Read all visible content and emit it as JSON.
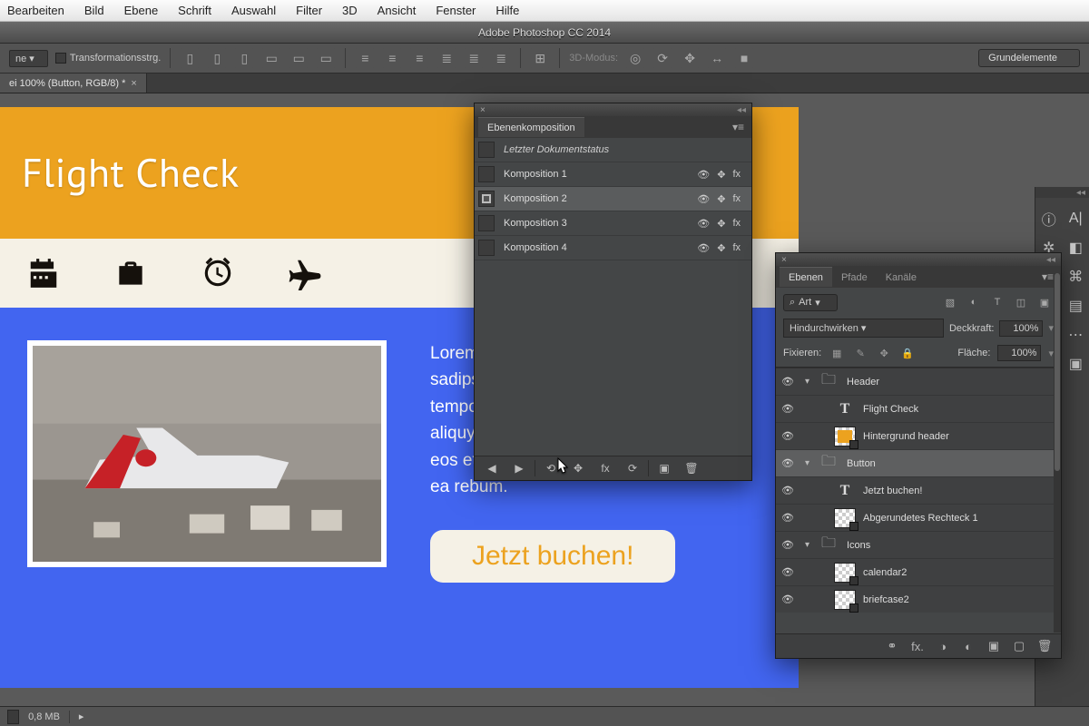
{
  "os_menu": [
    "Bearbeiten",
    "Bild",
    "Ebene",
    "Schrift",
    "Auswahl",
    "Filter",
    "3D",
    "Ansicht",
    "Fenster",
    "Hilfe"
  ],
  "app_title": "Adobe Photoshop CC 2014",
  "optbar": {
    "dropdown": "ne",
    "checkbox_label": "Transformationsstrg.",
    "mode3d_label": "3D-Modus:",
    "workspace": "Grundelemente"
  },
  "doctab": "ei 100% (Button, RGB/8) *",
  "canvas": {
    "heading": "Flight Check",
    "paragraph": "Lorem ipsum dolor sit amet, sadipscing elitr, sed diam eirmod tempor invidunt ut dolore magna aliquyam erat, voluptua. At vero eos et accu justo duo dolores et ea rebum.",
    "cta": "Jetzt buchen!"
  },
  "comp_panel": {
    "title": "Ebenenkomposition",
    "last_status": "Letzter Dokumentstatus",
    "rows": [
      {
        "label": "Komposition 1"
      },
      {
        "label": "Komposition 2"
      },
      {
        "label": "Komposition 3"
      },
      {
        "label": "Komposition 4"
      }
    ],
    "selected_index": 1
  },
  "layers_panel": {
    "tabs": [
      "Ebenen",
      "Pfade",
      "Kanäle"
    ],
    "kind": "Art",
    "blend_mode": "Hindurchwirken",
    "opacity_label": "Deckkraft:",
    "opacity_val": "100%",
    "lock_label": "Fixieren:",
    "fill_label": "Fläche:",
    "fill_val": "100%",
    "layers": [
      {
        "type": "group",
        "name": "Header",
        "indent": 0,
        "open": true
      },
      {
        "type": "text",
        "name": "Flight Check",
        "indent": 1
      },
      {
        "type": "shape",
        "name": "Hintergrund header",
        "indent": 1,
        "thumb": "orange"
      },
      {
        "type": "group",
        "name": "Button",
        "indent": 0,
        "open": true,
        "selected": true
      },
      {
        "type": "text",
        "name": "Jetzt buchen!",
        "indent": 1
      },
      {
        "type": "shape",
        "name": "Abgerundetes Rechteck 1",
        "indent": 1,
        "thumb": "trans"
      },
      {
        "type": "group",
        "name": "Icons",
        "indent": 0,
        "open": true
      },
      {
        "type": "shape",
        "name": "calendar2",
        "indent": 1,
        "thumb": "trans"
      },
      {
        "type": "shape",
        "name": "briefcase2",
        "indent": 1,
        "thumb": "trans"
      }
    ]
  },
  "status": {
    "size": "0,8 MB"
  },
  "search_icon": "⌕"
}
